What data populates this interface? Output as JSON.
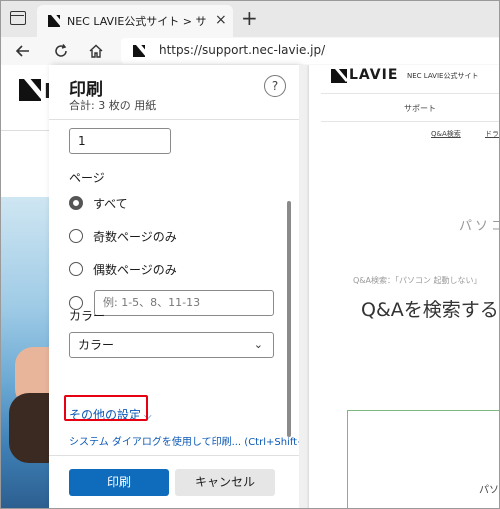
{
  "browser": {
    "tab_title": "NEC LAVIE公式サイト > サービス＆",
    "tab_close": "×",
    "new_tab": "+",
    "url": "https://support.nec-lavie.jp/",
    "back_icon": "arrow-left-icon",
    "reload_icon": "reload-icon",
    "home_icon": "home-icon"
  },
  "left_site": {
    "letter": "L"
  },
  "print_panel": {
    "title": "印刷",
    "subtitle": "合計: 3 枚の 用紙",
    "help": "?",
    "copies_value": "1",
    "pages_label": "ページ",
    "pages_options": [
      {
        "label": "すべて",
        "checked": true
      },
      {
        "label": "奇数ページのみ",
        "checked": false
      },
      {
        "label": "偶数ページのみ",
        "checked": false
      }
    ],
    "range_placeholder": "例: 1-5、8、11-13",
    "color_label": "カラー",
    "color_value": "カラー",
    "more_settings": "その他の設定",
    "system_dialog": "システム ダイアログを使用して印刷... (Ctrl+Shift+P)",
    "print_button": "印刷",
    "cancel_button": "キャンセル",
    "highlight_color": "#e60012",
    "accent_color": "#0f6cbd"
  },
  "preview": {
    "brand": "LAVIE",
    "site_name": "NEC LAVIE公式サイト",
    "support": "サポート",
    "qa_link": "Q&A検索",
    "driver_link": "ドラ",
    "pc_text": "パソコ",
    "qa_search_label": "Q&A検索：「パソコン 起動しない」",
    "qa_heading": "Q&Aを検索する",
    "pasoko": "パソ"
  }
}
